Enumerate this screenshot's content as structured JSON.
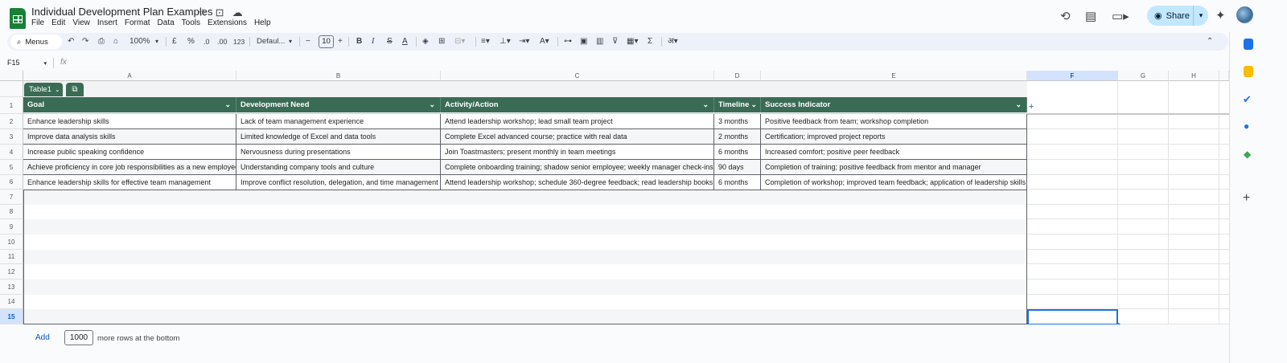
{
  "title": "Individual Development Plan Examples",
  "menu": [
    "File",
    "Edit",
    "View",
    "Insert",
    "Format",
    "Data",
    "Tools",
    "Extensions",
    "Help"
  ],
  "share_label": "Share",
  "toolbar": {
    "menus_label": "Menus",
    "zoom": "100%",
    "currency": "£",
    "percent": "%",
    "dec_less": ".0",
    "dec_more": ".00",
    "number_format": "123",
    "font": "Defaul...",
    "font_size": "10",
    "hindi_glyph": "अ"
  },
  "name_box": "F15",
  "fx_label": "fx",
  "columns": [
    "A",
    "B",
    "C",
    "D",
    "E",
    "F",
    "G",
    "H"
  ],
  "rows": [
    "1",
    "2",
    "3",
    "4",
    "5",
    "6",
    "7",
    "8",
    "9",
    "10",
    "11",
    "12",
    "13",
    "14",
    "15"
  ],
  "table_name": "Table1",
  "table_headers": [
    "Goal",
    "Development Need",
    "Activity/Action",
    "Timeline",
    "Success Indicator"
  ],
  "table_rows": [
    [
      "Enhance leadership skills",
      "Lack of team management experience",
      "Attend leadership workshop; lead small team project",
      "3 months",
      "Positive feedback from team; workshop completion"
    ],
    [
      "Improve data analysis skills",
      "Limited knowledge of Excel and data tools",
      "Complete Excel advanced course; practice with real data",
      "2 months",
      "Certification; improved project reports"
    ],
    [
      "Increase public speaking confidence",
      "Nervousness during presentations",
      "Join Toastmasters; present monthly in team meetings",
      "6 months",
      "Increased comfort; positive peer feedback"
    ],
    [
      "Achieve proficiency in core job responsibilities as a new employee",
      "Understanding company tools and culture",
      "Complete onboarding training; shadow senior employee; weekly manager check-ins",
      "90 days",
      "Completion of training; positive feedback from mentor and manager"
    ],
    [
      "Enhance leadership skills for effective team management",
      "Improve conflict resolution, delegation, and time management",
      "Attend leadership workshop; schedule 360-degree feedback; read leadership books",
      "6 months",
      "Completion of workshop; improved team feedback; application of leadership skills"
    ]
  ],
  "add_rows": {
    "button": "Add",
    "count": "1000",
    "suffix": "more rows at the bottom"
  },
  "colors": {
    "table_header": "#3a6b55",
    "share_bg": "#c2e7ff",
    "selection": "#1a73e8",
    "sheets_green": "#188038"
  }
}
